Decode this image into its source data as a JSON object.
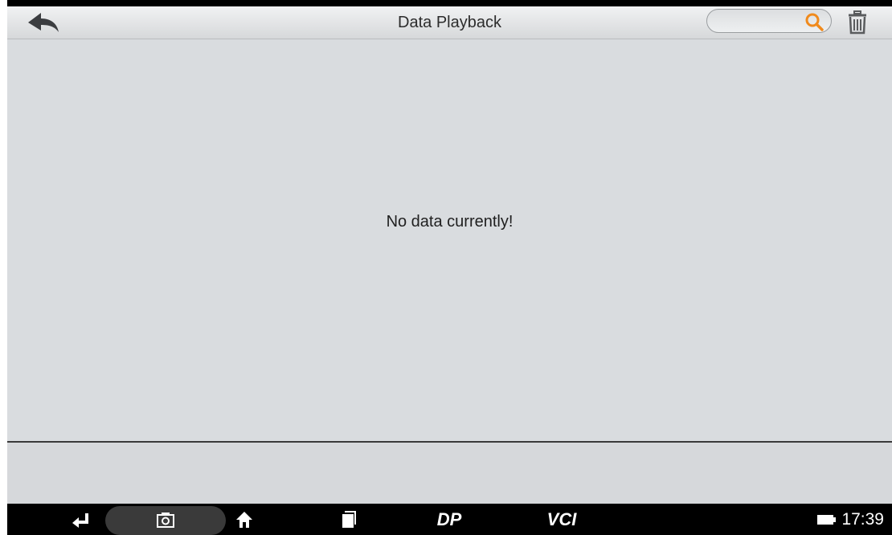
{
  "header": {
    "title": "Data Playback",
    "search": {
      "value": "",
      "placeholder": ""
    }
  },
  "content": {
    "empty_message": "No data currently!"
  },
  "navbar": {
    "items": [
      {
        "name": "back",
        "icon": "back-arrow-icon"
      },
      {
        "name": "screenshot",
        "icon": "camera-icon"
      },
      {
        "name": "home",
        "icon": "home-icon"
      },
      {
        "name": "recent-apps",
        "icon": "recent-apps-icon"
      },
      {
        "name": "dp",
        "label": "DP"
      },
      {
        "name": "vci",
        "label": "VCI"
      }
    ],
    "time": "17:39"
  },
  "colors": {
    "title_bar": "#e4e6e8",
    "content_bg": "#d9dcdf",
    "search_icon": "#f08a1c",
    "nav_bg": "#000000"
  }
}
